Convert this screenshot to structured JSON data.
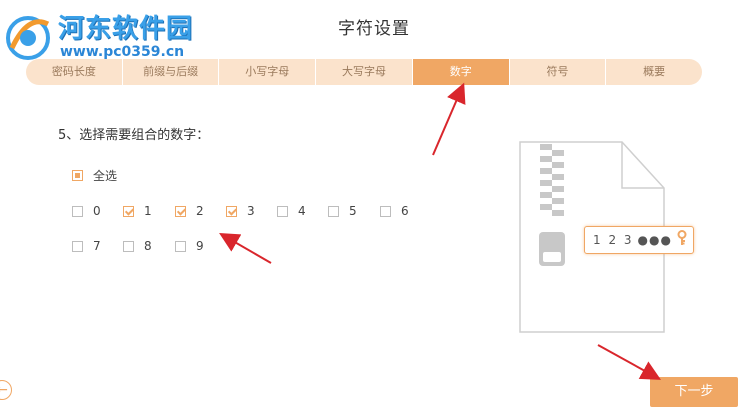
{
  "watermark": {
    "title": "河东软件园",
    "url": "www.pc0359.cn"
  },
  "page": {
    "title": "字符设置"
  },
  "tabs": [
    {
      "label": "密码长度",
      "active": false
    },
    {
      "label": "前缀与后缀",
      "active": false
    },
    {
      "label": "小写字母",
      "active": false
    },
    {
      "label": "大写字母",
      "active": false
    },
    {
      "label": "数字",
      "active": true
    },
    {
      "label": "符号",
      "active": false
    },
    {
      "label": "概要",
      "active": false
    }
  ],
  "prompt": "5、选择需要组合的数字：",
  "select_all": {
    "label": "全选",
    "state": "partial"
  },
  "digits": [
    {
      "label": "0",
      "checked": false
    },
    {
      "label": "1",
      "checked": true
    },
    {
      "label": "2",
      "checked": true
    },
    {
      "label": "3",
      "checked": true
    },
    {
      "label": "4",
      "checked": false
    },
    {
      "label": "5",
      "checked": false
    },
    {
      "label": "6",
      "checked": false
    },
    {
      "label": "7",
      "checked": false
    },
    {
      "label": "8",
      "checked": false
    },
    {
      "label": "9",
      "checked": false
    }
  ],
  "illustration": {
    "digits": "1 2 3",
    "dots": "●●●",
    "icon": "key-icon"
  },
  "buttons": {
    "next": "下一步",
    "back_icon": "back-icon"
  },
  "colors": {
    "accent": "#f0a764",
    "tab_bg": "#fbe3cc",
    "arrow": "#d9262c"
  }
}
